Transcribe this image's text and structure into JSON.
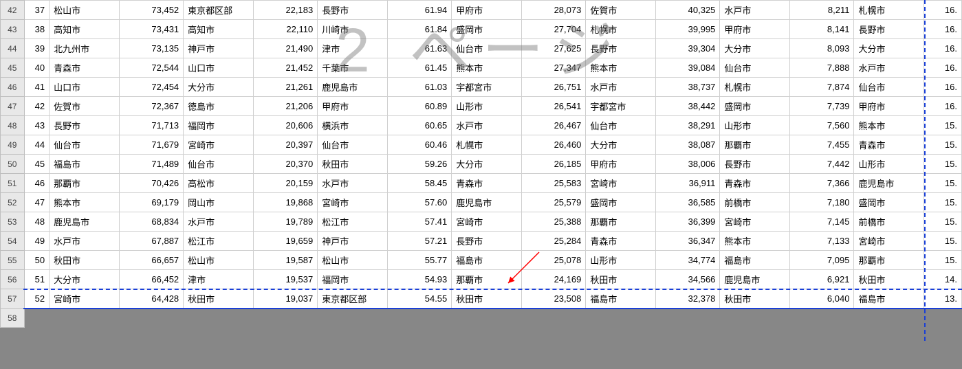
{
  "watermark": "2 ページ",
  "startRowHeader": 42,
  "pageBreak": {
    "horizontalAfterRowIndex": 14,
    "verticalRightOfColGroup": 7
  },
  "rows": [
    {
      "n": 37,
      "c1": "松山市",
      "v1": "73,452",
      "c2": "東京都区部",
      "v2": "22,183",
      "c3": "長野市",
      "v3": "61.94",
      "c4": "甲府市",
      "v4": "28,073",
      "c5": "佐賀市",
      "v5": "40,325",
      "c6": "水戸市",
      "v6": "8,211",
      "c7": "札幌市",
      "v7": "16."
    },
    {
      "n": 38,
      "c1": "高知市",
      "v1": "73,431",
      "c2": "高知市",
      "v2": "22,110",
      "c3": "川崎市",
      "v3": "61.84",
      "c4": "盛岡市",
      "v4": "27,704",
      "c5": "札幌市",
      "v5": "39,995",
      "c6": "甲府市",
      "v6": "8,141",
      "c7": "長野市",
      "v7": "16."
    },
    {
      "n": 39,
      "c1": "北九州市",
      "v1": "73,135",
      "c2": "神戸市",
      "v2": "21,490",
      "c3": "津市",
      "v3": "61.63",
      "c4": "仙台市",
      "v4": "27,625",
      "c5": "長野市",
      "v5": "39,304",
      "c6": "大分市",
      "v6": "8,093",
      "c7": "大分市",
      "v7": "16."
    },
    {
      "n": 40,
      "c1": "青森市",
      "v1": "72,544",
      "c2": "山口市",
      "v2": "21,452",
      "c3": "千葉市",
      "v3": "61.45",
      "c4": "熊本市",
      "v4": "27,347",
      "c5": "熊本市",
      "v5": "39,084",
      "c6": "仙台市",
      "v6": "7,888",
      "c7": "水戸市",
      "v7": "16."
    },
    {
      "n": 41,
      "c1": "山口市",
      "v1": "72,454",
      "c2": "大分市",
      "v2": "21,261",
      "c3": "鹿児島市",
      "v3": "61.03",
      "c4": "宇都宮市",
      "v4": "26,751",
      "c5": "水戸市",
      "v5": "38,737",
      "c6": "札幌市",
      "v6": "7,874",
      "c7": "仙台市",
      "v7": "16."
    },
    {
      "n": 42,
      "c1": "佐賀市",
      "v1": "72,367",
      "c2": "徳島市",
      "v2": "21,206",
      "c3": "甲府市",
      "v3": "60.89",
      "c4": "山形市",
      "v4": "26,541",
      "c5": "宇都宮市",
      "v5": "38,442",
      "c6": "盛岡市",
      "v6": "7,739",
      "c7": "甲府市",
      "v7": "16."
    },
    {
      "n": 43,
      "c1": "長野市",
      "v1": "71,713",
      "c2": "福岡市",
      "v2": "20,606",
      "c3": "横浜市",
      "v3": "60.65",
      "c4": "水戸市",
      "v4": "26,467",
      "c5": "仙台市",
      "v5": "38,291",
      "c6": "山形市",
      "v6": "7,560",
      "c7": "熊本市",
      "v7": "15."
    },
    {
      "n": 44,
      "c1": "仙台市",
      "v1": "71,679",
      "c2": "宮崎市",
      "v2": "20,397",
      "c3": "仙台市",
      "v3": "60.46",
      "c4": "札幌市",
      "v4": "26,460",
      "c5": "大分市",
      "v5": "38,087",
      "c6": "那覇市",
      "v6": "7,455",
      "c7": "青森市",
      "v7": "15."
    },
    {
      "n": 45,
      "c1": "福島市",
      "v1": "71,489",
      "c2": "仙台市",
      "v2": "20,370",
      "c3": "秋田市",
      "v3": "59.26",
      "c4": "大分市",
      "v4": "26,185",
      "c5": "甲府市",
      "v5": "38,006",
      "c6": "長野市",
      "v6": "7,442",
      "c7": "山形市",
      "v7": "15."
    },
    {
      "n": 46,
      "c1": "那覇市",
      "v1": "70,426",
      "c2": "高松市",
      "v2": "20,159",
      "c3": "水戸市",
      "v3": "58.45",
      "c4": "青森市",
      "v4": "25,583",
      "c5": "宮崎市",
      "v5": "36,911",
      "c6": "青森市",
      "v6": "7,366",
      "c7": "鹿児島市",
      "v7": "15."
    },
    {
      "n": 47,
      "c1": "熊本市",
      "v1": "69,179",
      "c2": "岡山市",
      "v2": "19,868",
      "c3": "宮崎市",
      "v3": "57.60",
      "c4": "鹿児島市",
      "v4": "25,579",
      "c5": "盛岡市",
      "v5": "36,585",
      "c6": "前橋市",
      "v6": "7,180",
      "c7": "盛岡市",
      "v7": "15."
    },
    {
      "n": 48,
      "c1": "鹿児島市",
      "v1": "68,834",
      "c2": "水戸市",
      "v2": "19,789",
      "c3": "松江市",
      "v3": "57.41",
      "c4": "宮崎市",
      "v4": "25,388",
      "c5": "那覇市",
      "v5": "36,399",
      "c6": "宮崎市",
      "v6": "7,145",
      "c7": "前橋市",
      "v7": "15."
    },
    {
      "n": 49,
      "c1": "水戸市",
      "v1": "67,887",
      "c2": "松江市",
      "v2": "19,659",
      "c3": "神戸市",
      "v3": "57.21",
      "c4": "長野市",
      "v4": "25,284",
      "c5": "青森市",
      "v5": "36,347",
      "c6": "熊本市",
      "v6": "7,133",
      "c7": "宮崎市",
      "v7": "15."
    },
    {
      "n": 50,
      "c1": "秋田市",
      "v1": "66,657",
      "c2": "松山市",
      "v2": "19,587",
      "c3": "松山市",
      "v3": "55.77",
      "c4": "福島市",
      "v4": "25,078",
      "c5": "山形市",
      "v5": "34,774",
      "c6": "福島市",
      "v6": "7,095",
      "c7": "那覇市",
      "v7": "15."
    },
    {
      "n": 51,
      "c1": "大分市",
      "v1": "66,452",
      "c2": "津市",
      "v2": "19,537",
      "c3": "福岡市",
      "v3": "54.93",
      "c4": "那覇市",
      "v4": "24,169",
      "c5": "秋田市",
      "v5": "34,566",
      "c6": "鹿児島市",
      "v6": "6,921",
      "c7": "秋田市",
      "v7": "14."
    },
    {
      "n": 52,
      "c1": "宮崎市",
      "v1": "64,428",
      "c2": "秋田市",
      "v2": "19,037",
      "c3": "東京都区部",
      "v3": "54.55",
      "c4": "秋田市",
      "v4": "23,508",
      "c5": "福島市",
      "v5": "32,378",
      "c6": "秋田市",
      "v6": "6,040",
      "c7": "福島市",
      "v7": "13."
    }
  ]
}
